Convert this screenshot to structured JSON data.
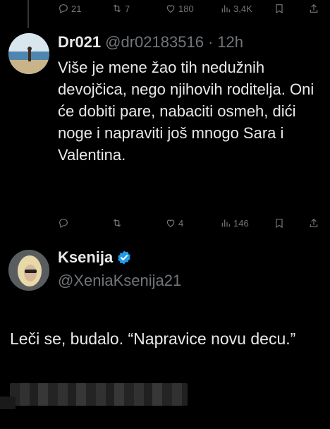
{
  "top_actions": {
    "replies": "21",
    "reposts": "7",
    "likes": "180",
    "views": "3,4K"
  },
  "tweet1": {
    "display_name": "Dr021",
    "handle": "@dr02183516",
    "separator": "·",
    "time": "12h",
    "text": "Više je mene žao tih nedužnih devojčica, nego njihovih roditelja. Oni će dobiti pare, nabaciti osmeh, dići noge i napraviti još mnogo Sara i Valentina.",
    "actions": {
      "replies": "",
      "reposts": "",
      "likes": "4",
      "views": "146"
    }
  },
  "tweet2": {
    "display_name": "Ksenija",
    "handle": "@XeniaKsenija21",
    "text": "Leči se, budalo. “Napravice novu decu.”",
    "verified_color": "#1d9bf0"
  },
  "icons": [
    "reply-icon",
    "repost-icon",
    "like-icon",
    "views-icon",
    "bookmark-icon",
    "share-icon",
    "verified-icon"
  ]
}
